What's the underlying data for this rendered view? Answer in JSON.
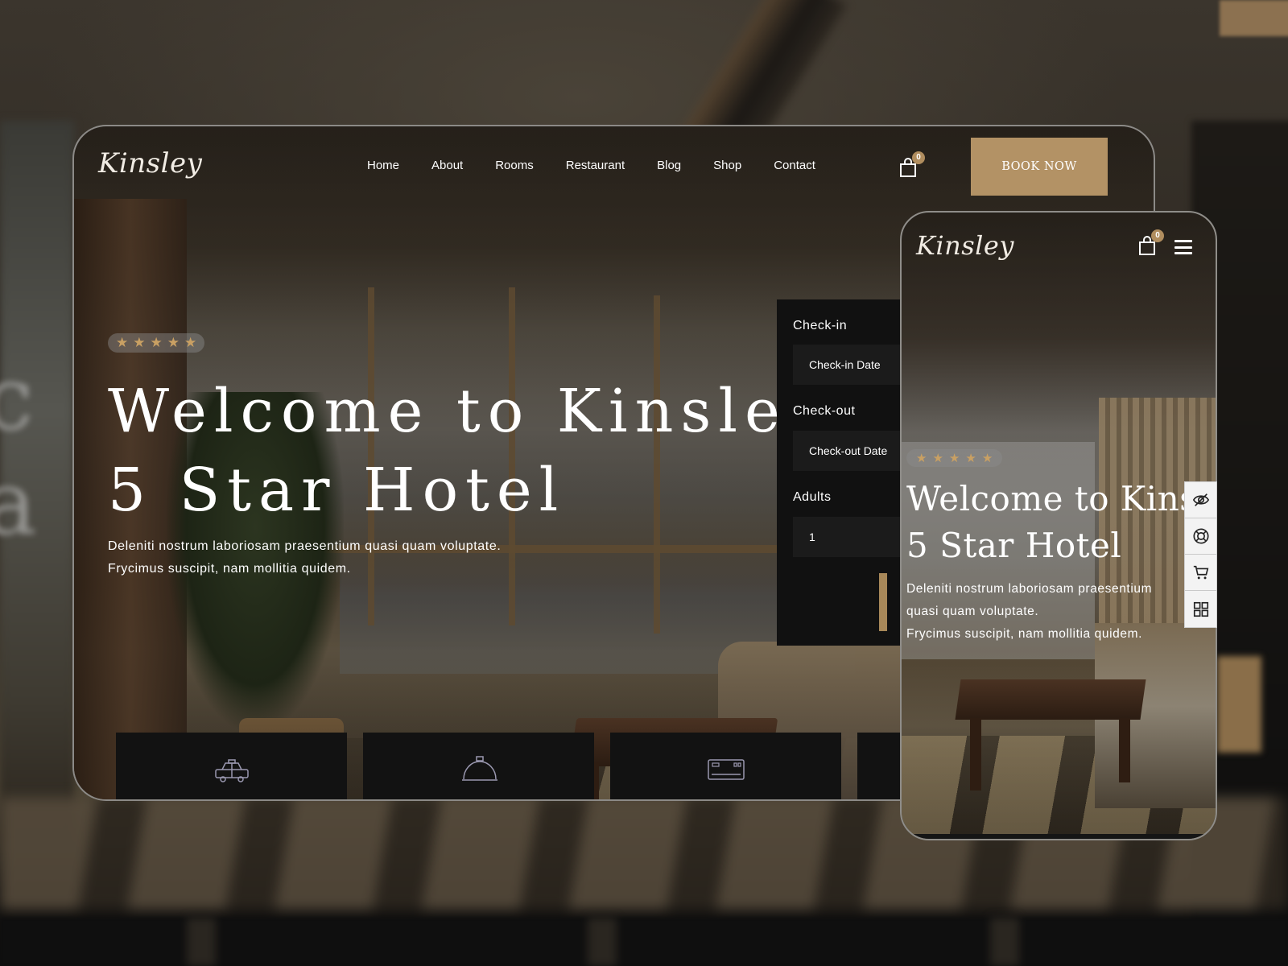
{
  "desktop": {
    "logo": "Kinsley",
    "nav": [
      "Home",
      "About",
      "Rooms",
      "Restaurant",
      "Blog",
      "Shop",
      "Contact"
    ],
    "cart_count": "0",
    "book_button": "BOOK NOW",
    "rating_stars": 5,
    "hero": {
      "title_line1": "Welcome to Kinsley",
      "title_line2": "5 Star Hotel",
      "subtitle_line1": "Deleniti nostrum laboriosam praesentium quasi quam voluptate.",
      "subtitle_line2": "Frycimus suscipit, nam mollitia quidem."
    },
    "booking": {
      "checkin_label": "Check-in",
      "checkin_placeholder": "Check-in Date",
      "checkout_label": "Check-out",
      "checkout_placeholder": "Check-out Date",
      "adults_label": "Adults",
      "adults_value": "1"
    },
    "features": [
      {
        "icon": "taxi-icon"
      },
      {
        "icon": "room-service-icon"
      },
      {
        "icon": "air-conditioner-icon"
      }
    ]
  },
  "mobile": {
    "logo": "Kinsley",
    "cart_count": "0",
    "rating_stars": 5,
    "hero": {
      "title_line1": "Welcome to Kinsley",
      "title_line2": "5 Star Hotel",
      "subtitle_line1": "Deleniti nostrum laboriosam praesentium",
      "subtitle_line2": "quasi quam voluptate.",
      "subtitle_line3": "Frycimus suscipit, nam mollitia quidem."
    },
    "side_tools": [
      "hide-icon",
      "support-icon",
      "cart-icon",
      "grid-icon"
    ]
  },
  "colors": {
    "accent_gold": "#b39265",
    "star": "#c9a063",
    "booking_bg": "#111111"
  }
}
